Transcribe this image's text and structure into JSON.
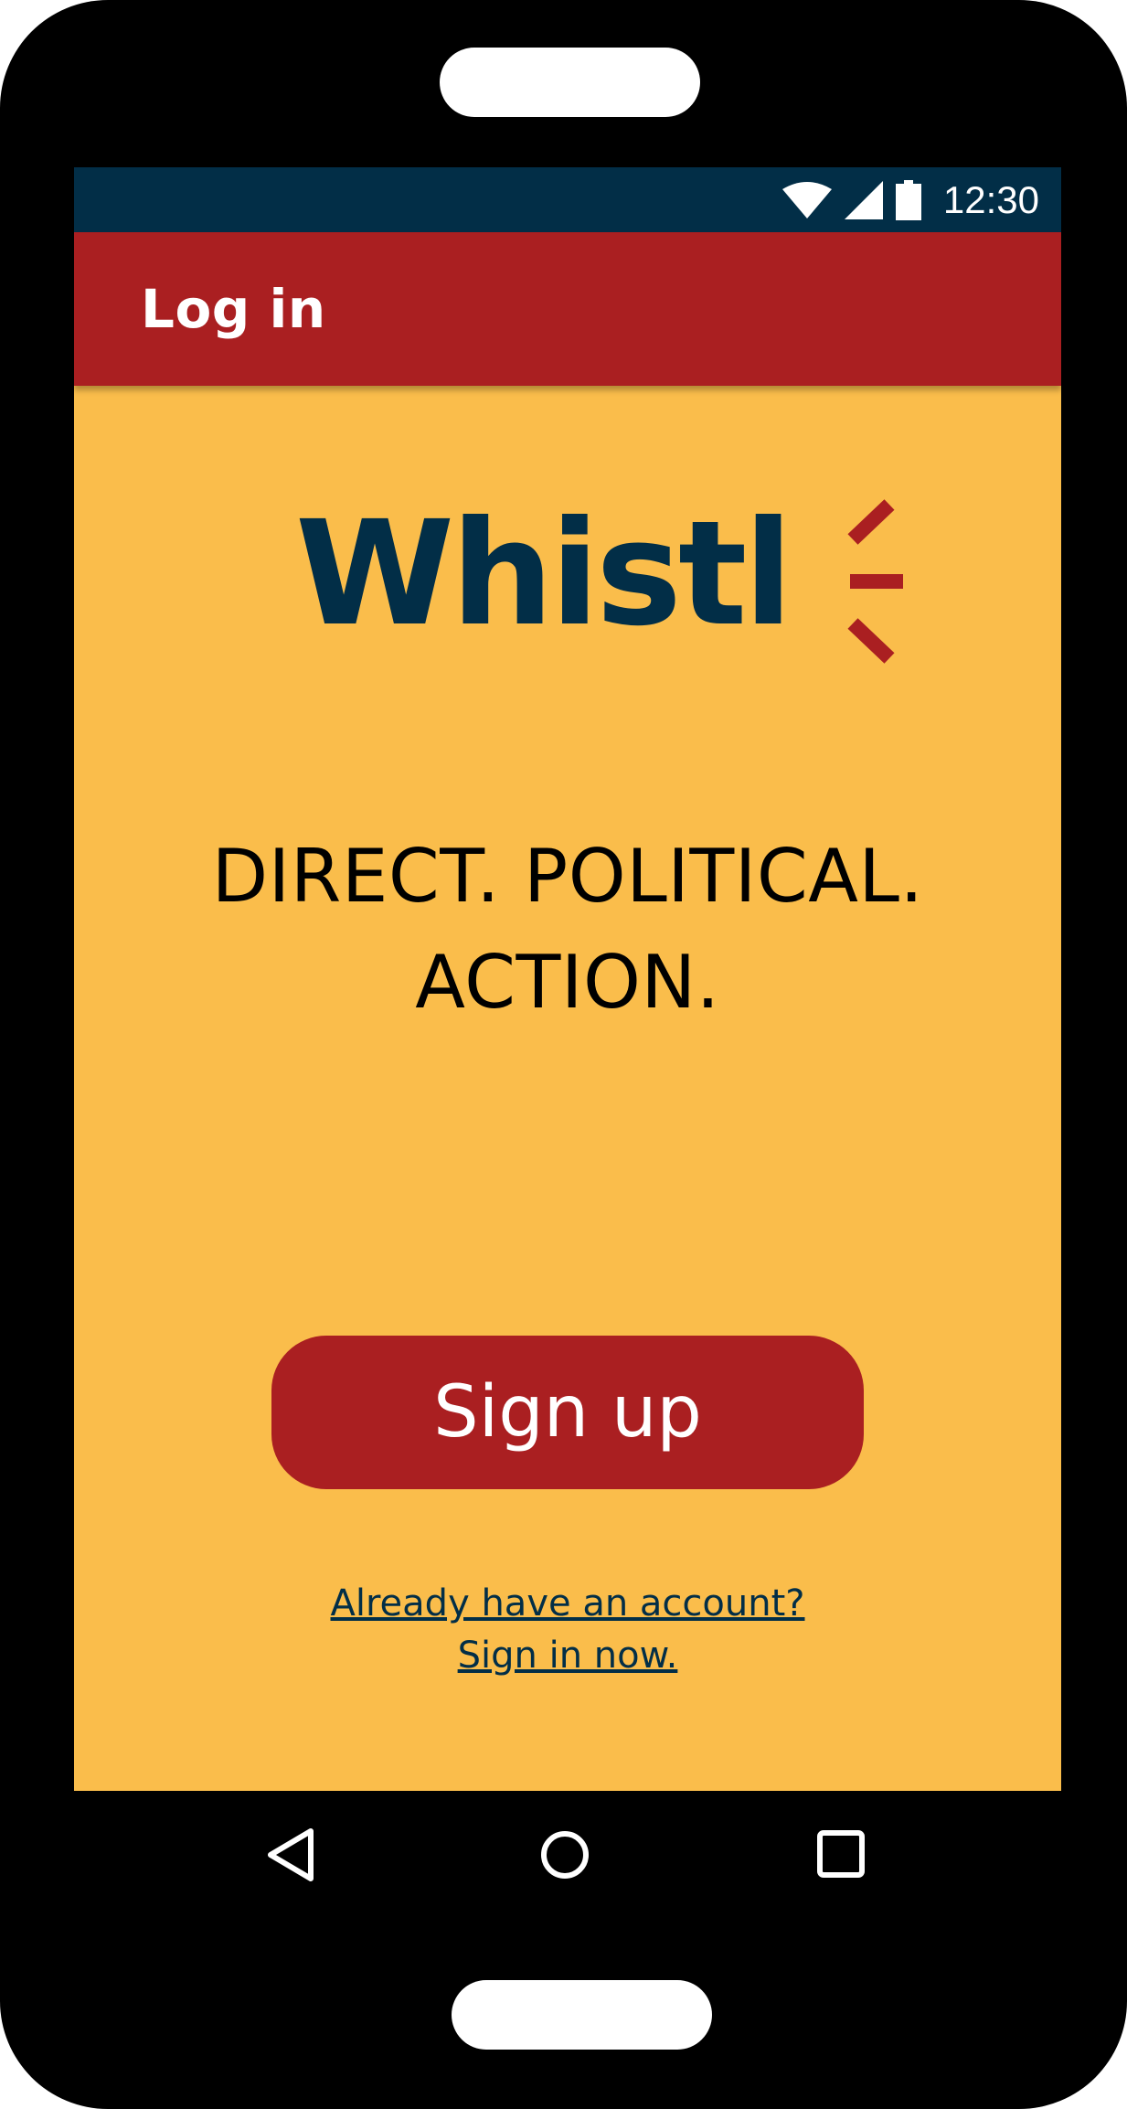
{
  "status_bar": {
    "time": "12:30",
    "icons": [
      "wifi-icon",
      "cellular-signal-icon",
      "battery-icon"
    ]
  },
  "app_bar": {
    "title": "Log in"
  },
  "logo": {
    "text": "Whistl"
  },
  "tagline": {
    "line1": "DIRECT. POLITICAL.",
    "line2": "ACTION."
  },
  "signup_button": {
    "label": "Sign up"
  },
  "signin_link": {
    "line1": "Already have an account?",
    "line2": "Sign in now."
  },
  "nav_bar": {
    "icons": [
      "back-icon",
      "home-icon",
      "recents-icon"
    ]
  },
  "colors": {
    "status_bar": "#022e47",
    "app_bar": "#aa1f21",
    "background": "#fabd4b",
    "logo": "#022e47",
    "button": "#aa1f21",
    "frame": "#000000"
  }
}
